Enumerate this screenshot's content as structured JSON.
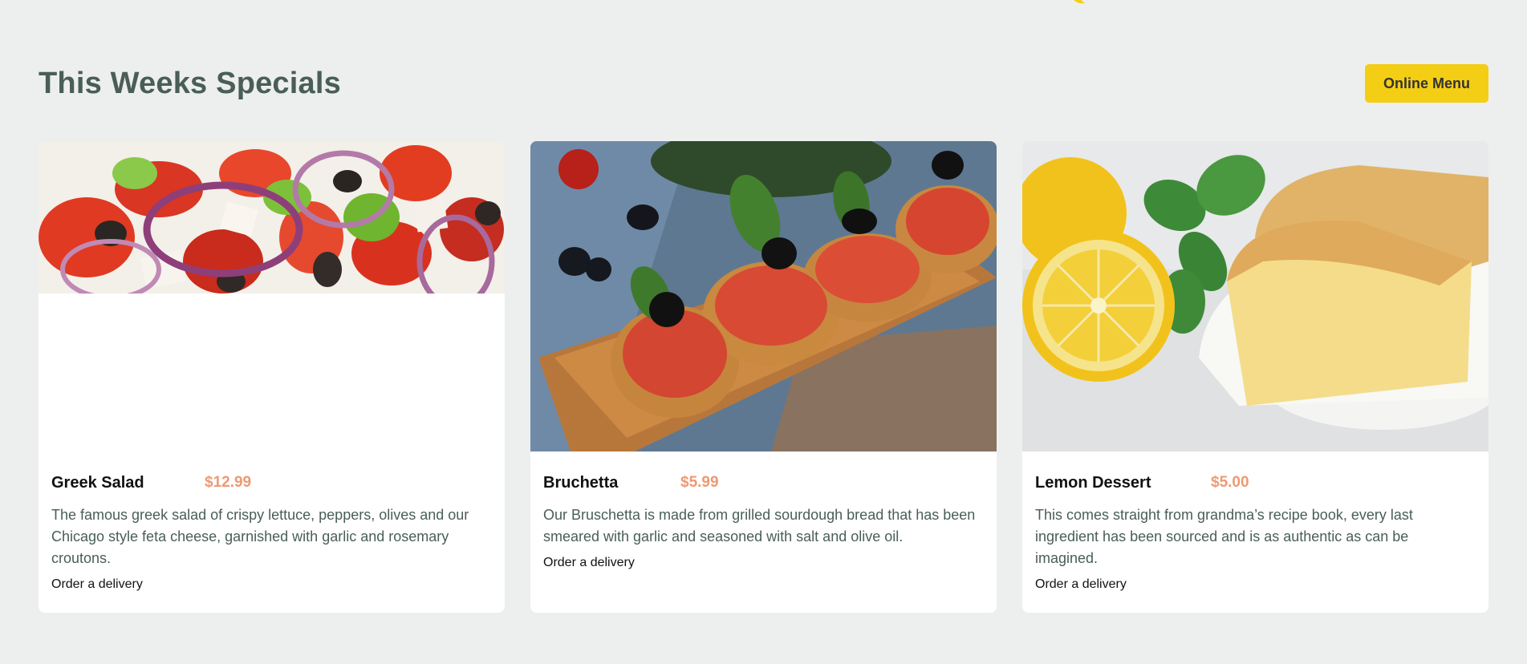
{
  "header": {
    "title": "This Weeks Specials",
    "menu_button": "Online Menu"
  },
  "colors": {
    "background": "#edefee",
    "primary_green": "#495e57",
    "accent_yellow": "#f4ce14",
    "price_orange": "#ee9972"
  },
  "specials": [
    {
      "name": "Greek Salad",
      "price": "$12.99",
      "description": "The famous greek salad of crispy lettuce, peppers, olives and our Chicago style feta cheese, garnished with garlic and rosemary croutons.",
      "order_label": "Order a delivery",
      "image": "greek-salad-photo"
    },
    {
      "name": "Bruchetta",
      "price": "$5.99",
      "description": "Our Bruschetta is made from grilled sourdough bread that has been smeared with garlic and seasoned with salt and olive oil.",
      "order_label": "Order a delivery",
      "image": "bruschetta-photo"
    },
    {
      "name": "Lemon Dessert",
      "price": "$5.00",
      "description": "This comes straight from grandma’s recipe book, every last ingredient has been sourced and is as authentic as can be imagined.",
      "order_label": "Order a delivery",
      "image": "lemon-dessert-photo"
    }
  ]
}
